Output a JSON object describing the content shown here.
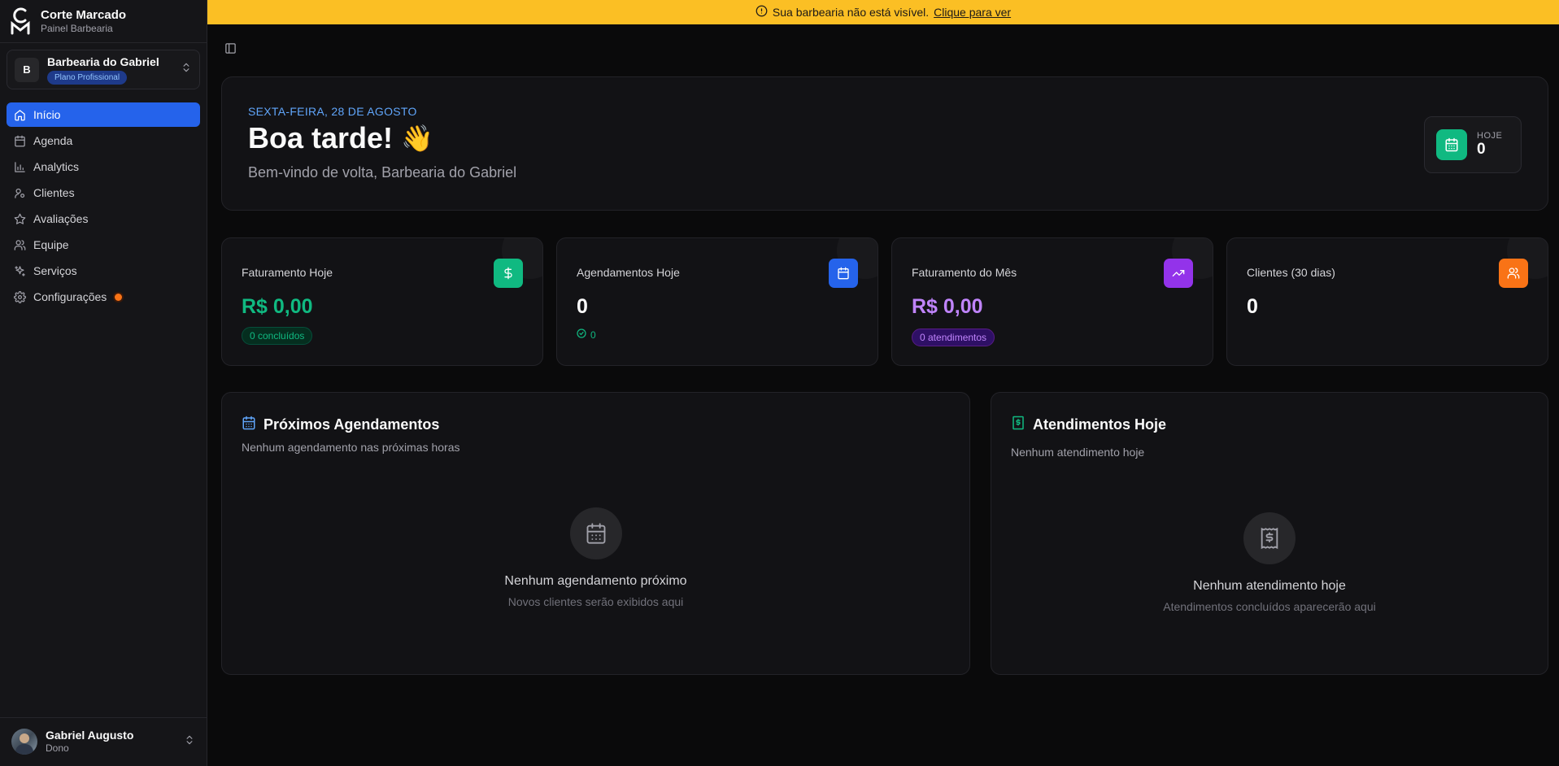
{
  "brand": {
    "title": "Corte Marcado",
    "subtitle": "Painel Barbearia"
  },
  "shop": {
    "initial": "B",
    "name": "Barbearia do Gabriel",
    "plan": "Plano Profissional"
  },
  "nav": [
    {
      "label": "Início",
      "icon": "home-icon",
      "active": true
    },
    {
      "label": "Agenda",
      "icon": "calendar-icon"
    },
    {
      "label": "Analytics",
      "icon": "bar-chart-icon"
    },
    {
      "label": "Clientes",
      "icon": "users-icon"
    },
    {
      "label": "Avaliações",
      "icon": "star-icon"
    },
    {
      "label": "Equipe",
      "icon": "team-icon"
    },
    {
      "label": "Serviços",
      "icon": "sparkles-icon"
    },
    {
      "label": "Configurações",
      "icon": "gear-icon",
      "notification": true
    }
  ],
  "user": {
    "name": "Gabriel Augusto",
    "role": "Dono"
  },
  "banner": {
    "text": "Sua barbearia não está visível.",
    "link": "Clique para ver"
  },
  "hero": {
    "date": "SEXTA-FEIRA, 28 DE AGOSTO",
    "greeting": "Boa tarde!",
    "emoji": "👋",
    "welcome": "Bem-vindo de volta, Barbearia do Gabriel",
    "today_label": "HOJE",
    "today_value": "0"
  },
  "stats": [
    {
      "label": "Faturamento Hoje",
      "value": "R$ 0,00",
      "badge": "0 concluídos",
      "color": "#10b981"
    },
    {
      "label": "Agendamentos Hoje",
      "value": "0",
      "check": "0",
      "color": "#2563eb"
    },
    {
      "label": "Faturamento do Mês",
      "value": "R$ 0,00",
      "badge": "0 atendimentos",
      "color": "#9333ea"
    },
    {
      "label": "Clientes (30 dias)",
      "value": "0",
      "color": "#f97316"
    }
  ],
  "upcoming": {
    "title": "Próximos Agendamentos",
    "subtitle": "Nenhum agendamento nas próximas horas",
    "empty_title": "Nenhum agendamento próximo",
    "empty_sub": "Novos clientes serão exibidos aqui"
  },
  "services_today": {
    "title": "Atendimentos Hoje",
    "subtitle": "Nenhum atendimento hoje",
    "empty_title": "Nenhum atendimento hoje",
    "empty_sub": "Atendimentos concluídos aparecerão aqui"
  },
  "colors": {
    "accent": "#2563eb",
    "banner": "#fbbf24",
    "success": "#10b981",
    "purple": "#c084fc",
    "orange": "#f97316"
  }
}
